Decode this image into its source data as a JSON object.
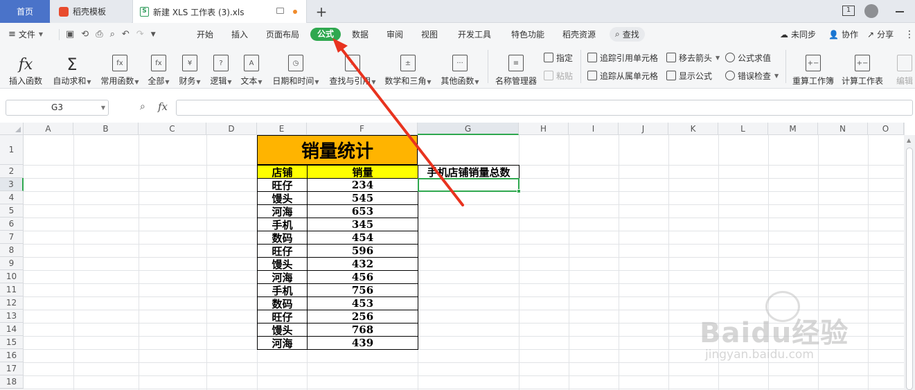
{
  "tabs": {
    "home": "首页",
    "template": "稻壳模板",
    "document": "新建 XLS 工作表 (3).xls",
    "badge": "1"
  },
  "menu": {
    "file": "文件",
    "items": [
      "开始",
      "插入",
      "页面布局",
      "公式",
      "数据",
      "审阅",
      "视图",
      "开发工具",
      "特色功能",
      "稻壳资源"
    ],
    "active": "公式",
    "search": "查找",
    "unsync": "未同步",
    "collab": "协作",
    "share": "分享"
  },
  "ribbon": {
    "insert_function": "插入函数",
    "autosum": "自动求和",
    "common_functions": "常用函数",
    "all": "全部",
    "finance": "财务",
    "logic": "逻辑",
    "text": "文本",
    "datetime": "日期和时间",
    "lookup": "查找与引用",
    "math": "数学和三角",
    "other": "其他函数",
    "name_manager": "名称管理器",
    "specify": "指定",
    "paste": "粘贴",
    "trace_precedents": "追踪引用单元格",
    "trace_dependents": "追踪从属单元格",
    "remove_arrows": "移去箭头",
    "show_formulas": "显示公式",
    "evaluate_formula": "公式求值",
    "error_check": "错误检查",
    "recalc_workbook": "重算工作簿",
    "calc_sheet": "计算工作表",
    "edit": "编辑"
  },
  "formula_bar": {
    "name_box": "G3",
    "fx": "fx",
    "formula": ""
  },
  "columns": [
    "A",
    "B",
    "C",
    "D",
    "E",
    "F",
    "G",
    "H",
    "I",
    "J",
    "K",
    "L",
    "M",
    "N",
    "O"
  ],
  "rows": [
    "1",
    "2",
    "3",
    "4",
    "5",
    "6",
    "7",
    "8",
    "9",
    "10",
    "11",
    "12",
    "13",
    "14",
    "15",
    "16",
    "17",
    "18"
  ],
  "sheet": {
    "title": "销量统计",
    "header_store": "店铺",
    "header_sales": "销量",
    "g2": "手机店铺销量总数",
    "records": [
      {
        "store": "旺仔",
        "sales": "234"
      },
      {
        "store": "馒头",
        "sales": "545"
      },
      {
        "store": "河海",
        "sales": "653"
      },
      {
        "store": "手机",
        "sales": "345"
      },
      {
        "store": "数码",
        "sales": "454"
      },
      {
        "store": "旺仔",
        "sales": "596"
      },
      {
        "store": "馒头",
        "sales": "432"
      },
      {
        "store": "河海",
        "sales": "456"
      },
      {
        "store": "手机",
        "sales": "756"
      },
      {
        "store": "数码",
        "sales": "453"
      },
      {
        "store": "旺仔",
        "sales": "256"
      },
      {
        "store": "馒头",
        "sales": "768"
      },
      {
        "store": "河海",
        "sales": "439"
      }
    ]
  },
  "colors": {
    "accent_green": "#2fa84f",
    "title_fill": "#ffb400",
    "header_fill": "#ffff00",
    "arrow": "#e8331f",
    "home_tab": "#4a73c9"
  },
  "watermark": {
    "brand": "Baidu经验",
    "url": "jingyan.baidu.com"
  }
}
